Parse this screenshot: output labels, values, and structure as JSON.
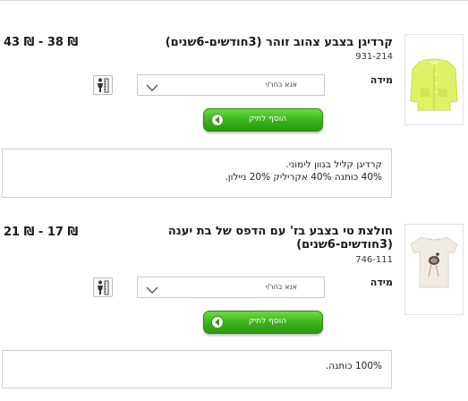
{
  "products": [
    {
      "title_lines": [
        "קרדיגן בצבע צהוב זוהר (3חודשים-6שנים)"
      ],
      "code": "931-214",
      "price": "₪ 38 - ₪ 43",
      "size_label": "מידה",
      "size_select": "אנא בחר/י",
      "cart_button": "הוסף לתיק",
      "description": [
        "קרדיגן קליל בגוון לימוני.",
        "40% כותנה 40% אקריליק 20% ניילון."
      ]
    },
    {
      "title_lines": [
        "חולצת טי בצבע בז' עם הדפס של בת יענה",
        "(3חודשים-6שנים)"
      ],
      "code": "746-111",
      "price": "₪ 17 - ₪ 21",
      "size_label": "מידה",
      "size_select": "אנא בחר/י",
      "cart_button": "הוסף לתיק",
      "description": [
        "100% כותנה."
      ]
    }
  ],
  "colors": {
    "cart_green": "#38b11a",
    "cardigan_yellow": "#d9f060",
    "tee_beige": "#f1ece2"
  },
  "icons": {
    "size_guide": "size-guide-icon",
    "select_arrow": "chevron-down-icon",
    "cart_arrow": "arrow-left-icon"
  }
}
